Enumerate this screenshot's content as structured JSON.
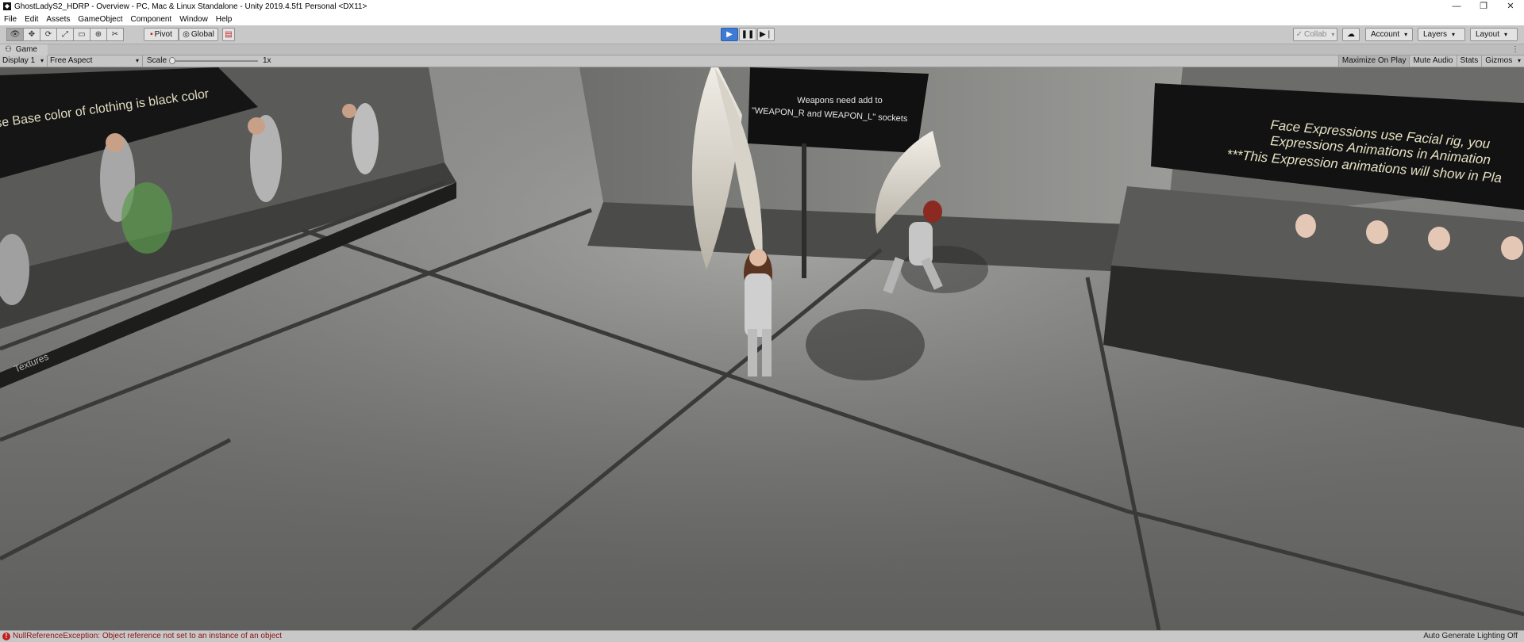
{
  "window": {
    "title": "GhostLadyS2_HDRP - Overview - PC, Mac & Linux Standalone - Unity 2019.4.5f1 Personal <DX11>",
    "minimize_glyph": "—",
    "maximize_glyph": "❐",
    "close_glyph": "✕"
  },
  "menu": [
    "File",
    "Edit",
    "Assets",
    "GameObject",
    "Component",
    "Window",
    "Help"
  ],
  "toolbar": {
    "tools": [
      {
        "name": "hand-tool",
        "glyph": "👁"
      },
      {
        "name": "move-tool",
        "glyph": "✥"
      },
      {
        "name": "rotate-tool",
        "glyph": "⟳"
      },
      {
        "name": "scale-tool",
        "glyph": "⤢"
      },
      {
        "name": "rect-tool",
        "glyph": "▭"
      },
      {
        "name": "transform-tool",
        "glyph": "⊕"
      },
      {
        "name": "custom-tool",
        "glyph": "✂"
      }
    ],
    "pivot_label": "Pivot",
    "global_label": "Global",
    "collab_label": "Collab",
    "account_label": "Account",
    "layers_label": "Layers",
    "layout_label": "Layout"
  },
  "game_tab": {
    "label": "Game"
  },
  "game_bar": {
    "display": "Display 1",
    "aspect": "Free Aspect",
    "scale_label": "Scale",
    "scale_value": "1x",
    "maximize_on_play": "Maximize On Play",
    "mute_audio": "Mute Audio",
    "stats": "Stats",
    "gizmos": "Gizmos"
  },
  "scene": {
    "left_sign": "se Base color of clothing is black color",
    "center_sign_line1": "Weapons need add to",
    "center_sign_line2": "\"WEAPON_R and WEAPON_L\" sockets",
    "right_sign_line1": "Face Expressions use Facial rig, you",
    "right_sign_line2": "Expressions Animations in Animation",
    "right_sign_line3": "***This Expression animations will show in Pla",
    "floor_label": "Textures"
  },
  "status": {
    "error_icon": "!",
    "message": "NullReferenceException: Object reference not set to an instance of an object",
    "lighting": "Auto Generate Lighting Off"
  },
  "colors": {
    "play_active": "#3d7ad6",
    "error_red": "#c21f1f"
  }
}
